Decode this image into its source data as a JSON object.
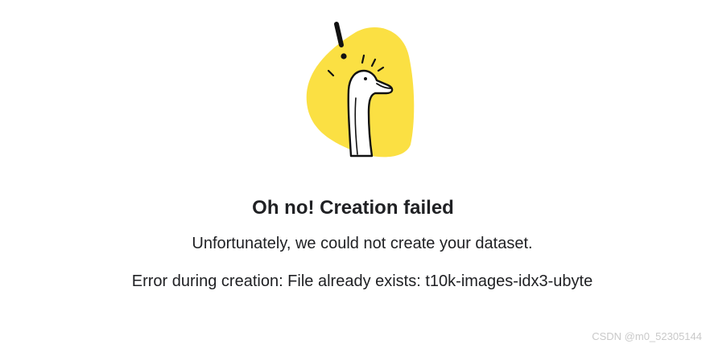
{
  "dialog": {
    "title": "Oh no! Creation failed",
    "message": "Unfortunately, we could not create your dataset.",
    "error": "Error during creation: File already exists: t10k-images-idx3-ubyte"
  },
  "illustration": {
    "name": "error-goose",
    "blob_color": "#FBE043"
  },
  "watermark": "CSDN @m0_52305144"
}
